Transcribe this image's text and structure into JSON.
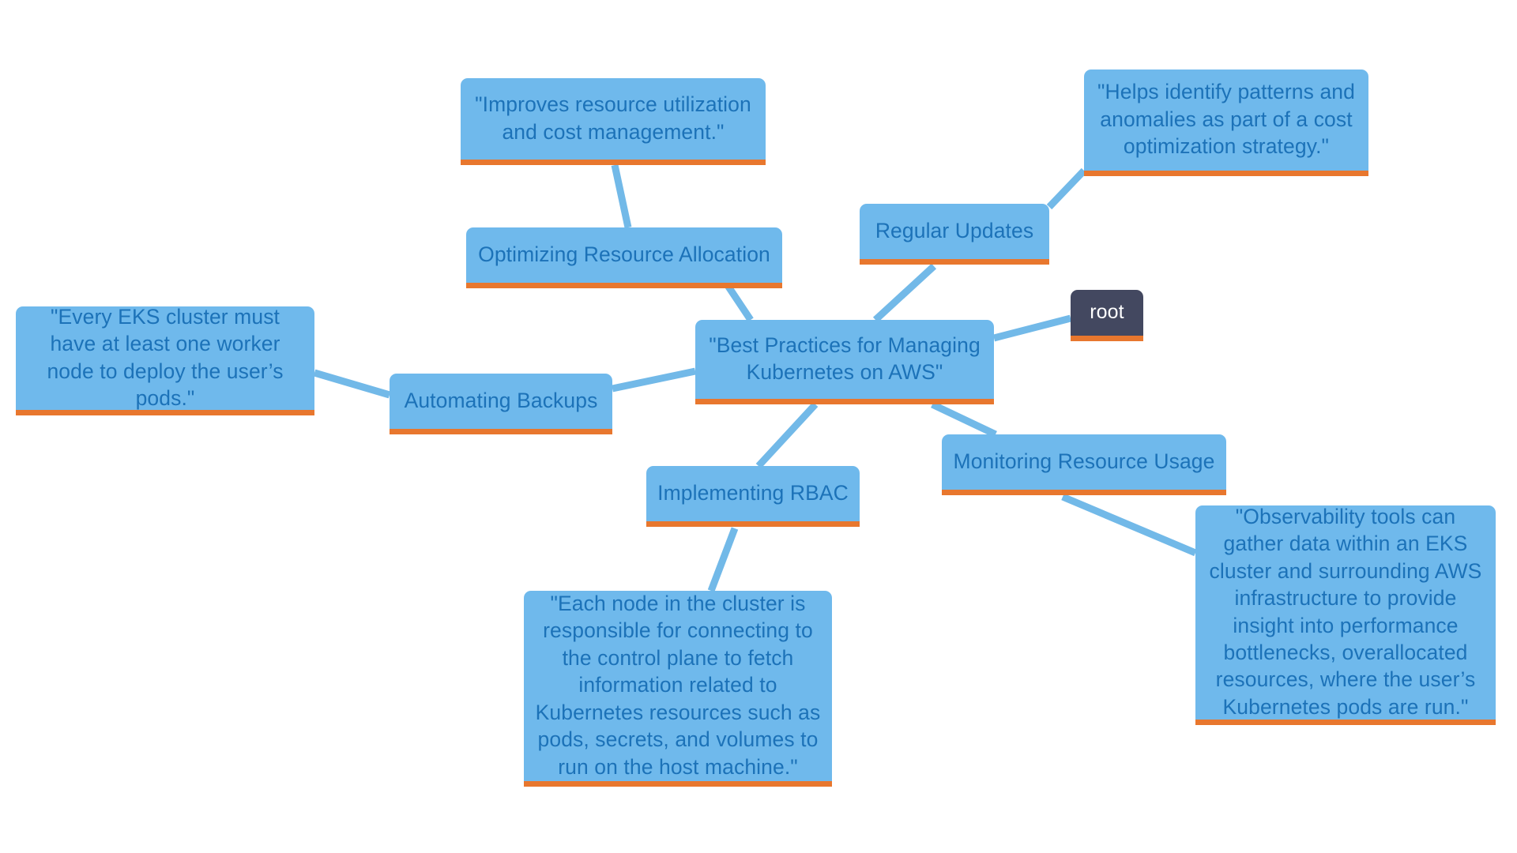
{
  "diagram": {
    "type": "mindmap",
    "title": "Best Practices for Managing Kubernetes on AWS",
    "colors": {
      "node_fill": "#6fb9ec",
      "node_text": "#1c72b8",
      "node_accent_border": "#e8772e",
      "root_fill": "#434860",
      "root_text": "#ffffff",
      "edge": "#72b9e8",
      "background": "#ffffff"
    },
    "nodes": {
      "root": {
        "label": "root"
      },
      "center": {
        "label": "\"Best Practices for Managing Kubernetes on AWS\""
      },
      "optimizing_resource_allocation": {
        "label": "Optimizing Resource Allocation"
      },
      "improves_resource_utilization": {
        "label": "\"Improves resource utilization and cost management.\""
      },
      "regular_updates": {
        "label": "Regular Updates"
      },
      "helps_identify_patterns": {
        "label": "\"Helps identify patterns and anomalies as part of a cost optimization strategy.\""
      },
      "automating_backups": {
        "label": "Automating Backups"
      },
      "every_eks_cluster": {
        "label": "\"Every EKS cluster must have at least one worker node to deploy the user’s pods.\""
      },
      "implementing_rbac": {
        "label": "Implementing RBAC"
      },
      "each_node_in_cluster": {
        "label": "\"Each node in the cluster is responsible for connecting to the control plane to fetch information related to Kubernetes resources such as pods, secrets, and volumes to run on the host machine.\""
      },
      "monitoring_resource_usage": {
        "label": "Monitoring Resource Usage"
      },
      "observability_tools": {
        "label": "\"Observability tools can gather data within an EKS cluster and surrounding AWS infrastructure to provide insight into performance bottlenecks, overallocated resources, where the user’s Kubernetes pods are run.\""
      }
    },
    "edges": [
      {
        "from": "root",
        "to": "center"
      },
      {
        "from": "center",
        "to": "optimizing_resource_allocation"
      },
      {
        "from": "optimizing_resource_allocation",
        "to": "improves_resource_utilization"
      },
      {
        "from": "center",
        "to": "regular_updates"
      },
      {
        "from": "regular_updates",
        "to": "helps_identify_patterns"
      },
      {
        "from": "center",
        "to": "automating_backups"
      },
      {
        "from": "automating_backups",
        "to": "every_eks_cluster"
      },
      {
        "from": "center",
        "to": "implementing_rbac"
      },
      {
        "from": "implementing_rbac",
        "to": "each_node_in_cluster"
      },
      {
        "from": "center",
        "to": "monitoring_resource_usage"
      },
      {
        "from": "monitoring_resource_usage",
        "to": "observability_tools"
      }
    ]
  }
}
